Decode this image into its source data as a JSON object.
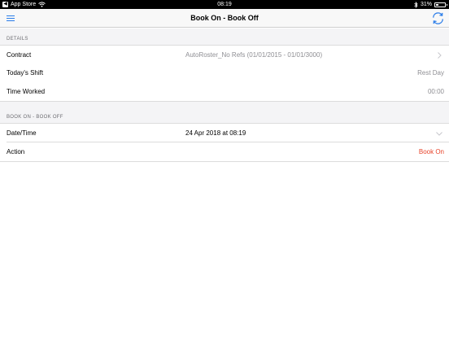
{
  "status_bar": {
    "back_app": "App Store",
    "time": "08:19",
    "battery_text": "31%",
    "battery_level": 0.31
  },
  "nav": {
    "title": "Book On - Book Off"
  },
  "details": {
    "header": "DETAILS",
    "rows": [
      {
        "label": "Contract",
        "value": "AutoRoster_No Refs (01/01/2015 - 01/01/3000)"
      },
      {
        "label": "Today's Shift",
        "value": "Rest Day"
      },
      {
        "label": "Time Worked",
        "value": "00:00"
      }
    ]
  },
  "book": {
    "header": "BOOK ON - BOOK OFF",
    "rows": [
      {
        "label": "Date/Time",
        "value": "24 Apr 2018 at 08:19"
      },
      {
        "label": "Action",
        "value": "Book On"
      }
    ]
  },
  "colors": {
    "accent": "#2b7de9",
    "action": "#e8452c",
    "secondary_text": "#8e8e93",
    "section_bg": "#f4f4f6"
  }
}
